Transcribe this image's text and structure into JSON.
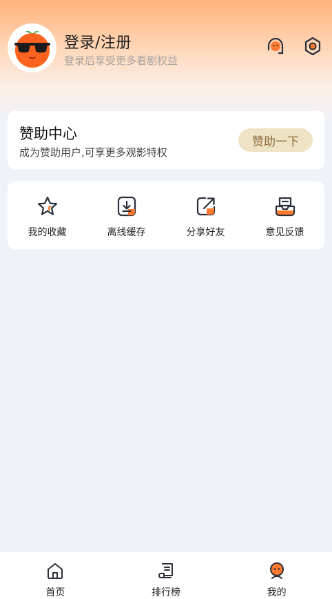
{
  "header": {
    "title": "登录/注册",
    "subtitle": "登录后享受更多看剧权益",
    "icons": [
      "customer-service-icon",
      "settings-icon"
    ]
  },
  "sponsor": {
    "title": "赞助中心",
    "subtitle": "成为赞助用户,可享更多观影特权",
    "button_label": "赞助一下"
  },
  "quick_actions": [
    {
      "label": "我的收藏",
      "icon": "star-icon"
    },
    {
      "label": "离线缓存",
      "icon": "download-icon"
    },
    {
      "label": "分享好友",
      "icon": "share-icon"
    },
    {
      "label": "意见反馈",
      "icon": "feedback-icon"
    }
  ],
  "bottom_nav": [
    {
      "label": "首页",
      "icon": "home-icon"
    },
    {
      "label": "排行榜",
      "icon": "ranking-icon"
    },
    {
      "label": "我的",
      "icon": "profile-icon",
      "active": true
    }
  ],
  "colors": {
    "accent": "#ff7a2e",
    "sponsor_button_bg": "#efe3c6",
    "sponsor_button_text": "#8b6b3c",
    "page_bg": "#eff3f7"
  }
}
